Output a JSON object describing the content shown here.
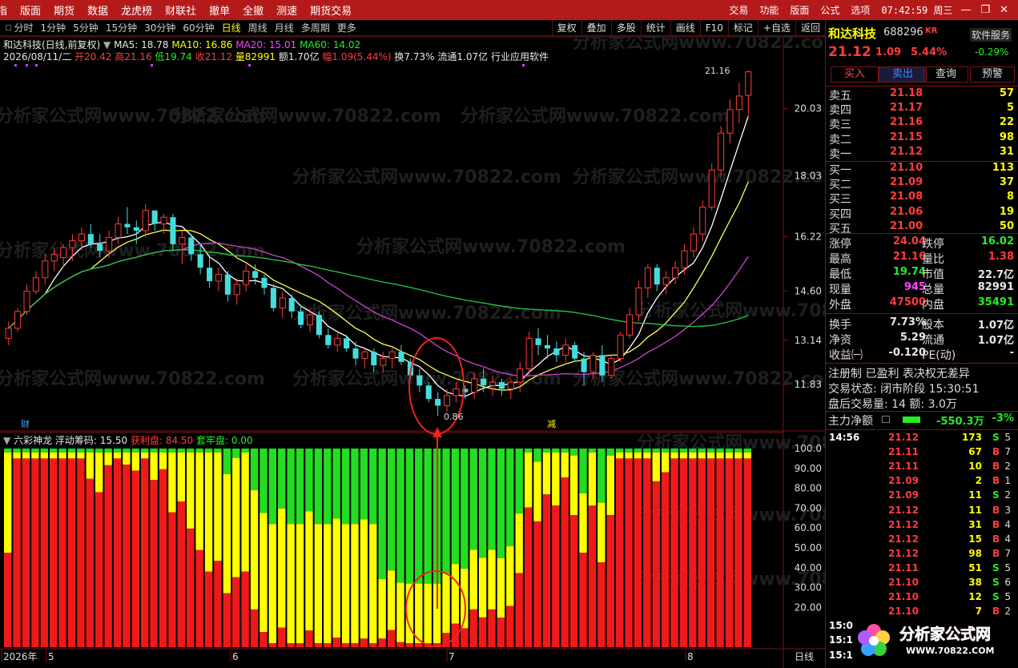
{
  "menu": {
    "items": [
      "指",
      "版面",
      "期货",
      "数据",
      "龙虎榜",
      "财联社",
      "撤单",
      "全撤",
      "测速",
      "期货交易"
    ],
    "right": [
      "交易",
      "功能",
      "版面",
      "公式",
      "选项"
    ],
    "clock": "07:42:59 周三"
  },
  "tabs": [
    "分时",
    "1分钟",
    "5分钟",
    "15分钟",
    "30分钟",
    "60分钟",
    "日线",
    "周线",
    "月线",
    "多周期",
    "更多"
  ],
  "active_tab": "日线",
  "toolbar": [
    "复权",
    "叠加",
    "多股",
    "统计",
    "画线",
    "F10",
    "标记",
    "+自选",
    "返回"
  ],
  "stock": {
    "name": "和达科技",
    "code": "688296",
    "badge": "KR",
    "service": "软件服务",
    "service_chg": "-0.29%",
    "price": "21.12",
    "chg": "1.09",
    "pct": "5.44%"
  },
  "quote": {
    "title": "和达科技(日线,前复权)",
    "ma5": "MA5: 18.78",
    "ma10": "MA10: 16.86",
    "ma20": "MA20: 15.01",
    "ma60": "MA60: 14.02",
    "date": "2026/08/11/二",
    "open": "开20.42",
    "high": "高21.16",
    "low": "低19.74",
    "close": "收21.12",
    "vol": "量82991",
    "amt": "额1.70亿",
    "range": "幅1.09(5.44%)",
    "turn": "换7.73%",
    "float": "流通1.07亿",
    "industry": "行业应用软件"
  },
  "actions": {
    "buy": "买入",
    "sell": "卖出",
    "query": "查询",
    "alert": "预警"
  },
  "orderbook": [
    {
      "label": "卖五",
      "price": "21.18",
      "vol": "57"
    },
    {
      "label": "卖四",
      "price": "21.17",
      "vol": "5"
    },
    {
      "label": "卖三",
      "price": "21.16",
      "vol": "22"
    },
    {
      "label": "卖二",
      "price": "21.15",
      "vol": "98"
    },
    {
      "label": "卖一",
      "price": "21.12",
      "vol": "31"
    },
    {
      "label": "买一",
      "price": "21.10",
      "vol": "113"
    },
    {
      "label": "买二",
      "price": "21.09",
      "vol": "37"
    },
    {
      "label": "买三",
      "price": "21.08",
      "vol": "8"
    },
    {
      "label": "买四",
      "price": "21.06",
      "vol": "19"
    },
    {
      "label": "买五",
      "price": "21.00",
      "vol": "50"
    }
  ],
  "stats": [
    {
      "l": "涨停",
      "lv": "24.04",
      "lc": "#ff3c3c",
      "r": "跌停",
      "rv": "16.02",
      "rc": "#22ee22"
    },
    {
      "l": "最高",
      "lv": "21.16",
      "lc": "#ff3c3c",
      "r": "量比",
      "rv": "1.38",
      "rc": "#ff3c3c"
    },
    {
      "l": "最低",
      "lv": "19.74",
      "lc": "#22ee22",
      "r": "市值",
      "rv": "22.7亿",
      "rc": "#e8e8e8"
    },
    {
      "l": "现量",
      "lv": "945",
      "lc": "#ff44ff",
      "r": "总量",
      "rv": "82991",
      "rc": "#e8e8e8"
    },
    {
      "l": "外盘",
      "lv": "47500",
      "lc": "#ff3c3c",
      "r": "内盘",
      "rv": "35491",
      "rc": "#22ee22"
    },
    {
      "l": "换手",
      "lv": "7.73%",
      "lc": "#e8e8e8",
      "r": "股本",
      "rv": "1.07亿",
      "rc": "#e8e8e8"
    },
    {
      "l": "净资",
      "lv": "5.29",
      "lc": "#e8e8e8",
      "r": "流通",
      "rv": "1.07亿",
      "rc": "#e8e8e8"
    },
    {
      "l": "收益㈠",
      "lv": "-0.120",
      "lc": "#e8e8e8",
      "r": "PE(动)",
      "rv": "-",
      "rc": "#e8e8e8"
    }
  ],
  "info": {
    "reg": "注册制 已盈利 表决权无差异",
    "state": "交易状态: 闭市阶段 15:30:51",
    "after": "盘后交易量: 14 额: 3.0万",
    "flow_label": "主力净额",
    "flow_val": "-550.3万",
    "flow_pct": "-3%"
  },
  "ticks": [
    {
      "t": "14:56",
      "p": "21.12",
      "v": "173",
      "s": "S",
      "n": "5"
    },
    {
      "t": "",
      "p": "21.11",
      "v": "67",
      "s": "B",
      "n": "7"
    },
    {
      "t": "",
      "p": "21.11",
      "v": "10",
      "s": "B",
      "n": "2"
    },
    {
      "t": "",
      "p": "21.09",
      "v": "2",
      "s": "B",
      "n": "1"
    },
    {
      "t": "",
      "p": "21.09",
      "v": "11",
      "s": "S",
      "n": "2"
    },
    {
      "t": "",
      "p": "21.12",
      "v": "11",
      "s": "B",
      "n": "3"
    },
    {
      "t": "",
      "p": "21.12",
      "v": "31",
      "s": "B",
      "n": "4"
    },
    {
      "t": "",
      "p": "21.12",
      "v": "15",
      "s": "B",
      "n": "4"
    },
    {
      "t": "",
      "p": "21.12",
      "v": "98",
      "s": "B",
      "n": "7"
    },
    {
      "t": "",
      "p": "21.11",
      "v": "51",
      "s": "S",
      "n": "5"
    },
    {
      "t": "",
      "p": "21.10",
      "v": "38",
      "s": "S",
      "n": "6"
    },
    {
      "t": "",
      "p": "21.10",
      "v": "12",
      "s": "S",
      "n": "5"
    },
    {
      "t": "",
      "p": "21.10",
      "v": "7",
      "s": "B",
      "n": "2"
    },
    {
      "t": "15:0",
      "p": "",
      "v": "",
      "s": "",
      "n": ""
    },
    {
      "t": "15:1",
      "p": "",
      "v": "",
      "s": "",
      "n": ""
    },
    {
      "t": "15:1",
      "p": "",
      "v": "",
      "s": "",
      "n": ""
    }
  ],
  "indicator": {
    "name": "六彩神龙",
    "float": "浮动筹码: 15.50",
    "profit": "获利盘: 84.50",
    "trap": "套牢盘: 0.00"
  },
  "axis": {
    "price_ticks": [
      "21.16",
      "20.03",
      "18.03",
      "16.22",
      "14.60",
      "13.14",
      "11.83"
    ],
    "ind_ticks": [
      "100.0",
      "90.00",
      "80.00",
      "70.00",
      "60.00",
      "50.00",
      "40.00",
      "30.00",
      "20.00"
    ],
    "x_labels": [
      "2026年",
      "5",
      "6",
      "7",
      "8"
    ],
    "period": "日线",
    "low_mark": "0.86",
    "high_mark": "21.16",
    "mark_cai": "财",
    "mark_jian": "减"
  },
  "watermark": "分析家公式网www.70822.com",
  "logo": {
    "text": "分析家公式网",
    "url": "WWW.70822.COM"
  },
  "chart_data": [
    {
      "type": "candlestick",
      "title": "和达科技(日线,前复权)",
      "ylim": [
        11.83,
        21.16
      ],
      "candles": [
        [
          13.2,
          13.7,
          13.0,
          13.5
        ],
        [
          13.5,
          14.1,
          13.4,
          14.0
        ],
        [
          14.0,
          14.8,
          13.9,
          14.6
        ],
        [
          14.6,
          15.2,
          14.5,
          15.0
        ],
        [
          15.0,
          15.7,
          14.8,
          15.5
        ],
        [
          15.5,
          15.9,
          15.2,
          15.7
        ],
        [
          15.6,
          16.0,
          15.3,
          15.9
        ],
        [
          15.9,
          16.3,
          15.5,
          16.1
        ],
        [
          16.1,
          16.5,
          15.8,
          16.3
        ],
        [
          16.3,
          16.6,
          15.9,
          16.0
        ],
        [
          16.0,
          16.3,
          15.6,
          15.8
        ],
        [
          15.8,
          16.4,
          15.6,
          16.2
        ],
        [
          16.2,
          16.8,
          16.0,
          16.6
        ],
        [
          16.6,
          17.1,
          16.3,
          16.5
        ],
        [
          16.5,
          16.7,
          16.0,
          16.4
        ],
        [
          16.4,
          17.2,
          16.2,
          17.0
        ],
        [
          17.0,
          17.0,
          16.4,
          16.6
        ],
        [
          16.6,
          16.9,
          16.3,
          16.8
        ],
        [
          16.8,
          16.9,
          15.8,
          16.0
        ],
        [
          16.0,
          16.4,
          15.4,
          16.2
        ],
        [
          16.2,
          16.3,
          15.5,
          15.7
        ],
        [
          15.7,
          16.0,
          15.1,
          15.3
        ],
        [
          15.3,
          15.6,
          14.7,
          14.9
        ],
        [
          14.9,
          15.3,
          14.6,
          15.1
        ],
        [
          15.1,
          15.2,
          14.3,
          14.5
        ],
        [
          14.5,
          15.0,
          14.2,
          14.8
        ],
        [
          14.8,
          15.4,
          14.6,
          15.2
        ],
        [
          15.2,
          15.4,
          14.8,
          15.0
        ],
        [
          15.0,
          15.1,
          14.5,
          14.7
        ],
        [
          14.7,
          14.8,
          14.0,
          14.1
        ],
        [
          14.1,
          14.6,
          13.8,
          14.4
        ],
        [
          14.4,
          14.5,
          13.8,
          14.0
        ],
        [
          14.0,
          14.2,
          13.5,
          13.6
        ],
        [
          13.6,
          14.1,
          13.4,
          13.9
        ],
        [
          13.9,
          14.0,
          13.2,
          13.3
        ],
        [
          13.3,
          13.5,
          12.9,
          13.0
        ],
        [
          13.0,
          13.4,
          12.8,
          13.2
        ],
        [
          13.2,
          13.3,
          12.8,
          12.9
        ],
        [
          12.9,
          13.1,
          12.4,
          12.6
        ],
        [
          12.6,
          12.9,
          12.3,
          12.8
        ],
        [
          12.8,
          12.9,
          12.2,
          12.4
        ],
        [
          12.4,
          12.8,
          12.2,
          12.6
        ],
        [
          12.6,
          12.9,
          12.3,
          12.8
        ],
        [
          12.8,
          13.0,
          12.4,
          12.5
        ],
        [
          12.5,
          12.6,
          12.0,
          12.1
        ],
        [
          12.1,
          12.3,
          11.6,
          11.8
        ],
        [
          11.8,
          11.9,
          11.3,
          11.4
        ],
        [
          11.4,
          11.6,
          10.9,
          11.2
        ],
        [
          11.2,
          11.7,
          11.0,
          11.5
        ],
        [
          11.5,
          11.9,
          11.3,
          11.7
        ],
        [
          11.7,
          11.8,
          11.4,
          11.6
        ],
        [
          11.6,
          12.2,
          11.4,
          12.0
        ],
        [
          12.0,
          12.3,
          11.6,
          11.8
        ],
        [
          11.8,
          12.1,
          11.5,
          11.9
        ],
        [
          11.9,
          12.0,
          11.5,
          11.7
        ],
        [
          11.7,
          12.0,
          11.4,
          11.9
        ],
        [
          11.9,
          12.5,
          11.6,
          12.3
        ],
        [
          12.3,
          13.4,
          12.1,
          13.2
        ],
        [
          13.2,
          13.5,
          12.7,
          13.0
        ],
        [
          13.0,
          13.3,
          12.6,
          12.9
        ],
        [
          12.9,
          13.1,
          12.5,
          12.7
        ],
        [
          12.7,
          13.2,
          12.5,
          13.0
        ],
        [
          13.0,
          13.1,
          12.5,
          12.6
        ],
        [
          12.6,
          12.8,
          11.8,
          12.2
        ],
        [
          12.2,
          12.8,
          12.0,
          12.7
        ],
        [
          12.7,
          13.0,
          11.9,
          12.1
        ],
        [
          12.1,
          12.7,
          12.0,
          12.6
        ],
        [
          12.6,
          13.4,
          12.5,
          13.3
        ],
        [
          13.3,
          14.1,
          13.2,
          13.9
        ],
        [
          13.9,
          14.9,
          13.7,
          14.7
        ],
        [
          14.7,
          15.4,
          14.4,
          15.3
        ],
        [
          15.3,
          15.4,
          14.6,
          14.8
        ],
        [
          14.8,
          15.2,
          14.5,
          15.0
        ],
        [
          15.0,
          15.5,
          14.8,
          15.3
        ],
        [
          15.3,
          16.0,
          15.1,
          15.8
        ],
        [
          15.8,
          16.5,
          15.6,
          16.3
        ],
        [
          16.3,
          17.3,
          16.1,
          17.1
        ],
        [
          17.1,
          18.4,
          17.0,
          18.2
        ],
        [
          18.2,
          19.5,
          18.0,
          19.3
        ],
        [
          19.3,
          20.3,
          19.0,
          20.0
        ],
        [
          20.0,
          20.8,
          19.6,
          20.4
        ],
        [
          20.42,
          21.16,
          19.74,
          21.12
        ]
      ]
    },
    {
      "type": "bar",
      "title": "六彩神龙",
      "ylim": [
        0,
        100
      ]
    }
  ]
}
